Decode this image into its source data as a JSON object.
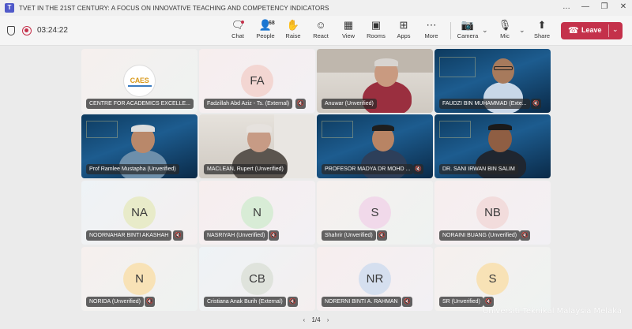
{
  "window": {
    "title": "TVET IN THE 21ST CENTURY: A FOCUS ON INNOVATIVE TEACHING AND COMPETENCY INDICATORS",
    "controls": [
      "…",
      "—",
      "❐",
      "✕"
    ]
  },
  "meeting": {
    "timer": "03:24:22"
  },
  "toolbar": {
    "chat": "Chat",
    "people": "People",
    "people_count": "68",
    "raise": "Raise",
    "react": "React",
    "view": "View",
    "rooms": "Rooms",
    "apps": "Apps",
    "more": "More",
    "camera": "Camera",
    "mic": "Mic",
    "share": "Share",
    "leave": "Leave"
  },
  "participants": [
    {
      "name": "CENTRE FOR ACADEMICS EXCELLE...",
      "logo_text": "CAES",
      "type": "logo"
    },
    {
      "name": "Fadzillah Abd Aziz - Ts. (External)",
      "initials": "FA",
      "avatar_color": "#f3d6d2",
      "type": "avatar"
    },
    {
      "name": "Anuwar (Unverified)",
      "type": "video"
    },
    {
      "name": "FAUDZI BIN MUHAMMAD (Exte...",
      "type": "video"
    },
    {
      "name": "Prof Ramlee Mustapha (Unverified)",
      "type": "video"
    },
    {
      "name": "MACLEAN, Rupert (Unverified)",
      "type": "video"
    },
    {
      "name": "PROFESOR MADYA DR MOHD ...",
      "type": "video"
    },
    {
      "name": "DR. SANI IRWAN BIN SALIM",
      "type": "video"
    },
    {
      "name": "NOORNAHAR BINTI AKASHAH",
      "initials": "NA",
      "avatar_color": "#e8ebc9",
      "type": "avatar"
    },
    {
      "name": "NASRIYAH (Unverified)",
      "initials": "N",
      "avatar_color": "#d8ecd6",
      "type": "avatar"
    },
    {
      "name": "Shahrir (Unverified)",
      "initials": "S",
      "avatar_color": "#f1d9ea",
      "type": "avatar"
    },
    {
      "name": "NORAINI BUANG (Unverified)",
      "initials": "NB",
      "avatar_color": "#f2dcdc",
      "type": "avatar"
    },
    {
      "name": "NORIDA (Unverified)",
      "initials": "N",
      "avatar_color": "#f8e2b6",
      "type": "avatar"
    },
    {
      "name": "Cristiana Anak Burih (External)",
      "initials": "CB",
      "avatar_color": "#dfe3dc",
      "type": "avatar"
    },
    {
      "name": "NORERNI BINTI A. RAHMAN",
      "initials": "NR",
      "avatar_color": "#d5dfef",
      "type": "avatar"
    },
    {
      "name": "SR (Unverified)",
      "initials": "S",
      "avatar_color": "#f8e2b6",
      "type": "avatar"
    }
  ],
  "pager": {
    "label": "1/4",
    "prev": "‹",
    "next": "›"
  },
  "watermark": "Universiti Teknikal Malaysia Melaka",
  "colors": {
    "leave": "#c4314b",
    "recording": "#c4314b"
  }
}
